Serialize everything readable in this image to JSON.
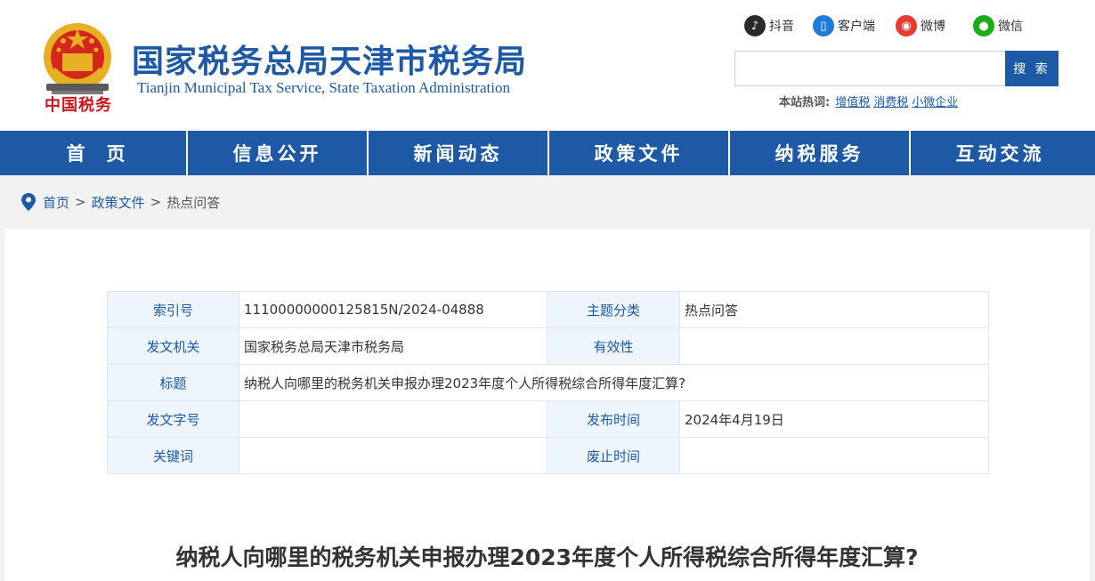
{
  "header": {
    "title": "国家税务总局天津市税务局",
    "subtitle": "Tianjin Municipal Tax Service, State Taxation Administration",
    "logo_text": "中国税务"
  },
  "social": [
    {
      "label": "抖音",
      "icon": "douyin-icon"
    },
    {
      "label": "客户端",
      "icon": "mobile-client-icon"
    },
    {
      "label": "微博",
      "icon": "weibo-icon"
    },
    {
      "label": "微信",
      "icon": "wechat-icon"
    }
  ],
  "search": {
    "placeholder": "",
    "button_label": "搜 索"
  },
  "hotwords": {
    "label": "本站热词:",
    "items": [
      "增值税",
      "消费税",
      "小微企业"
    ]
  },
  "nav": [
    "首页",
    "信息公开",
    "新闻动态",
    "政策文件",
    "纳税服务",
    "互动交流"
  ],
  "breadcrumb": {
    "items": [
      "首页",
      "政策文件",
      "热点问答"
    ],
    "separator": ">"
  },
  "meta": {
    "index_label": "索引号",
    "index_value": "11100000000125815N/2024-04888",
    "topic_label": "主题分类",
    "topic_value": "热点问答",
    "issuer_label": "发文机关",
    "issuer_value": "国家税务总局天津市税务局",
    "validity_label": "有效性",
    "validity_value": "",
    "title_label": "标题",
    "title_value": "纳税人向哪里的税务机关申报办理2023年度个人所得税综合所得年度汇算?",
    "docno_label": "发文字号",
    "docno_value": "",
    "pubdate_label": "发布时间",
    "pubdate_value": "2024年4月19日",
    "keywords_label": "关键词",
    "keywords_value": "",
    "expiry_label": "废止时间",
    "expiry_value": ""
  },
  "article": {
    "title": "纳税人向哪里的税务机关申报办理2023年度个人所得税综合所得年度汇算?"
  },
  "colors": {
    "brand_blue": "#1d59a5",
    "table_key_bg": "#eef5fc",
    "page_bg": "#f2f2f2"
  }
}
